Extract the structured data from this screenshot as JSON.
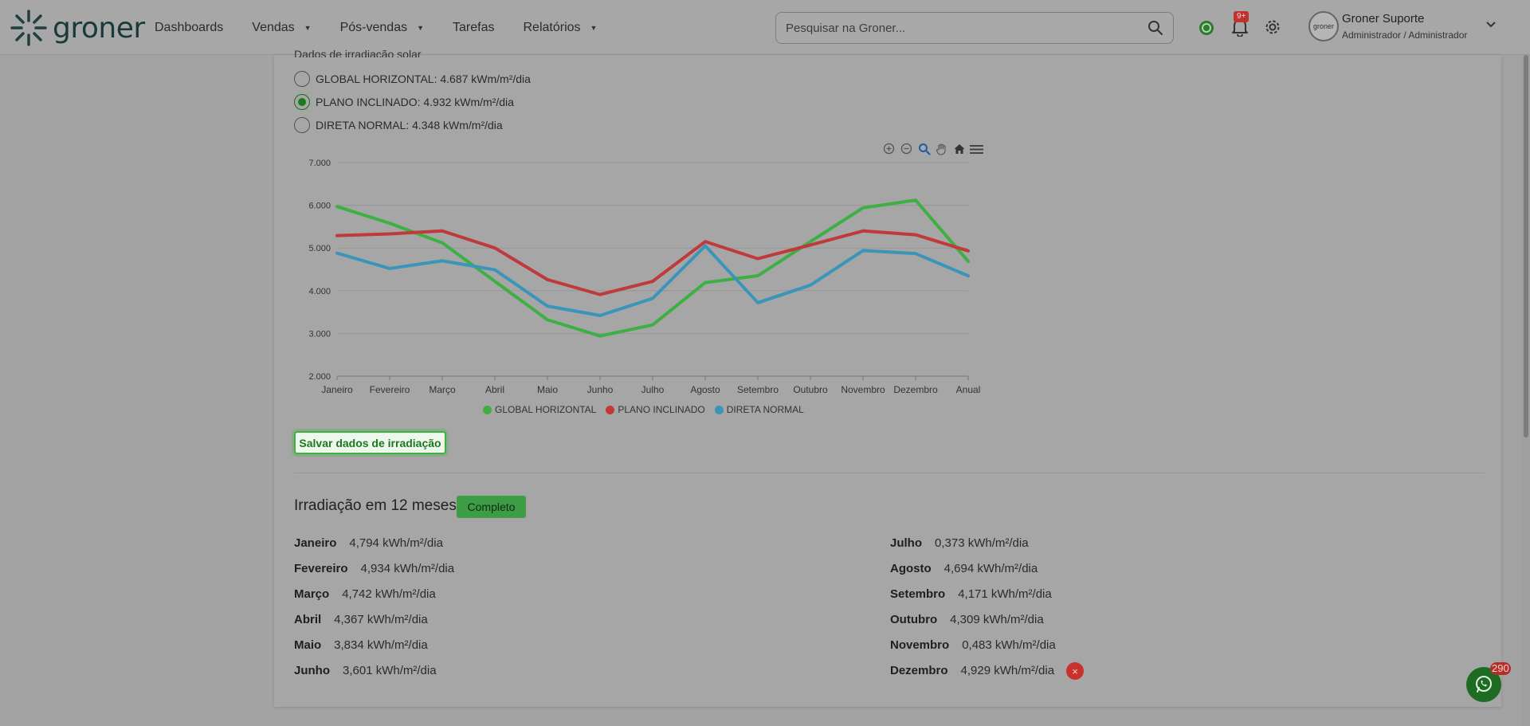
{
  "brand": {
    "name": "groner"
  },
  "nav": {
    "items": [
      {
        "label": "Dashboards",
        "has_menu": false
      },
      {
        "label": "Vendas",
        "has_menu": true
      },
      {
        "label": "Pós-vendas",
        "has_menu": true
      },
      {
        "label": "Tarefas",
        "has_menu": false
      },
      {
        "label": "Relatórios",
        "has_menu": true
      }
    ]
  },
  "search": {
    "placeholder": "Pesquisar na Groner..."
  },
  "notifications": {
    "count": "9+"
  },
  "user": {
    "name": "Groner Suporte",
    "role": "Administrador / Administrador",
    "avatar_text": "groner"
  },
  "irradiation": {
    "section_label": "Dados de irradiação solar",
    "options": [
      {
        "label": "GLOBAL HORIZONTAL: 4.687 kWm/m²/dia",
        "checked": false
      },
      {
        "label": "PLANO INCLINADO: 4.932 kWm/m²/dia",
        "checked": true
      },
      {
        "label": "DIRETA NORMAL: 4.348 kWm/m²/dia",
        "checked": false
      }
    ],
    "save_label": "Salvar dados de irradiação"
  },
  "chart_data": {
    "type": "line",
    "categories": [
      "Janeiro",
      "Fevereiro",
      "Março",
      "Abril",
      "Maio",
      "Junho",
      "Julho",
      "Agosto",
      "Setembro",
      "Outubro",
      "Novembro",
      "Dezembro",
      "Anual"
    ],
    "ylim": [
      2000,
      7000
    ],
    "y_ticks": [
      "7.000",
      "6.000",
      "5.000",
      "4.000",
      "3.000",
      "2.000"
    ],
    "grid": true,
    "legend_position": "bottom",
    "series": [
      {
        "name": "GLOBAL HORIZONTAL",
        "color": "#3cb043",
        "values": [
          5970,
          5580,
          5120,
          4220,
          3320,
          2940,
          3200,
          4190,
          4350,
          5150,
          5940,
          6120,
          4687
        ]
      },
      {
        "name": "PLANO INCLINADO",
        "color": "#c0393b",
        "values": [
          5290,
          5330,
          5400,
          5000,
          4260,
          3910,
          4220,
          5150,
          4750,
          5070,
          5400,
          5310,
          4932
        ]
      },
      {
        "name": "DIRETA NORMAL",
        "color": "#3a95b8",
        "values": [
          4880,
          4520,
          4700,
          4490,
          3640,
          3420,
          3820,
          5050,
          3720,
          4130,
          4940,
          4870,
          4348
        ]
      }
    ]
  },
  "months_panel": {
    "title": "Irradiação em 12 meses",
    "status": "Completo",
    "left": [
      {
        "month": "Janeiro",
        "value": "4,794 kWh/m²/dia"
      },
      {
        "month": "Fevereiro",
        "value": "4,934 kWh/m²/dia"
      },
      {
        "month": "Março",
        "value": "4,742 kWh/m²/dia"
      },
      {
        "month": "Abril",
        "value": "4,367 kWh/m²/dia"
      },
      {
        "month": "Maio",
        "value": "3,834 kWh/m²/dia"
      },
      {
        "month": "Junho",
        "value": "3,601 kWh/m²/dia"
      }
    ],
    "right": [
      {
        "month": "Julho",
        "value": "0,373 kWh/m²/dia"
      },
      {
        "month": "Agosto",
        "value": "4,694 kWh/m²/dia"
      },
      {
        "month": "Setembro",
        "value": "4,171 kWh/m²/dia"
      },
      {
        "month": "Outubro",
        "value": "4,309 kWh/m²/dia"
      },
      {
        "month": "Novembro",
        "value": "0,483 kWh/m²/dia"
      },
      {
        "month": "Dezembro",
        "value": "4,929 kWh/m²/dia"
      }
    ],
    "remove_symbol": "×"
  },
  "whatsapp": {
    "unread": "290"
  }
}
